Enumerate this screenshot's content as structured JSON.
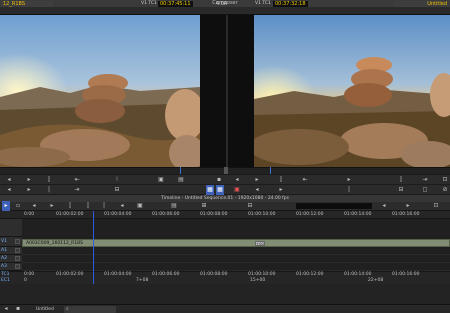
{
  "composer": {
    "title": "Composer"
  },
  "source": {
    "clip_name": "12_R1BS",
    "tc_label": "V1 TC1",
    "tc_value": "00:37:45:11"
  },
  "middle": {
    "duration": "4:04"
  },
  "record": {
    "tc_label": "V1 TC1",
    "tc_value": "00:37:32:18",
    "sequence_name": "Untitled"
  },
  "timeline": {
    "title": "Timeline - Untitled Sequence.01 - 1920x1080 - 24.00 fps",
    "ruler_ticks": [
      "0:00",
      "01:00:02:00",
      "01:00:04:00",
      "01:00:06:00",
      "01:00:08:00",
      "01:00:10:00",
      "01:00:12:00",
      "01:00:14:00",
      "01:00:16:00"
    ],
    "tracks": [
      {
        "label": "V1"
      },
      {
        "label": "A1"
      },
      {
        "label": "A2"
      },
      {
        "label": "A3"
      },
      {
        "label": "TC1"
      },
      {
        "label": "EC1"
      }
    ],
    "v1_clip": {
      "name": "A003C009_160112_R1BS",
      "badge": "+00"
    },
    "bottom_ticks": [
      "0:00",
      "01:00:02:00",
      "01:00:04:00",
      "01:00:06:00",
      "01:00:08:00",
      "01:00:10:00",
      "01:00:12:00",
      "01:00:14:00",
      "01:00:16:00"
    ],
    "ec_ticks": [
      "0",
      "7+08",
      "15+00",
      "22+08"
    ]
  },
  "status": {
    "project": "Untitled",
    "search_placeholder": ""
  },
  "colors": {
    "accent_yellow": "#f4d000",
    "playhead_blue": "#2f59e0",
    "clip_green": "#818e74"
  }
}
